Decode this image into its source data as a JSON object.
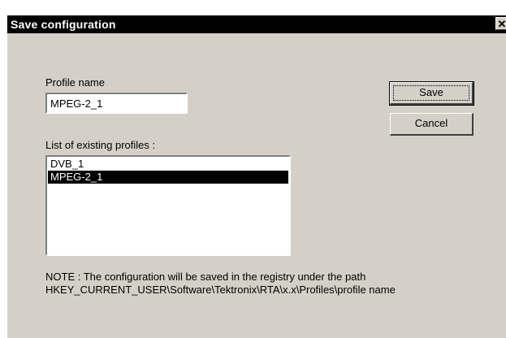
{
  "window": {
    "title": "Save configuration",
    "close_glyph": "✕"
  },
  "form": {
    "profile_name_label": "Profile name",
    "profile_name_value": "MPEG-2_1",
    "list_label": "List of existing profiles :",
    "profiles": [
      {
        "label": "DVB_1",
        "selected": false
      },
      {
        "label": "MPEG-2_1",
        "selected": true
      }
    ]
  },
  "buttons": {
    "save": "Save",
    "cancel": "Cancel"
  },
  "note": {
    "line1": "NOTE : The configuration will be saved in the registry under the path",
    "line2": "HKEY_CURRENT_USER\\Software\\Tektronix\\RTA\\x.x\\Profiles\\profile name"
  },
  "colors": {
    "dialog_bg": "#d4d0c8",
    "titlebar_bg": "#000000",
    "selection_bg": "#000000"
  }
}
